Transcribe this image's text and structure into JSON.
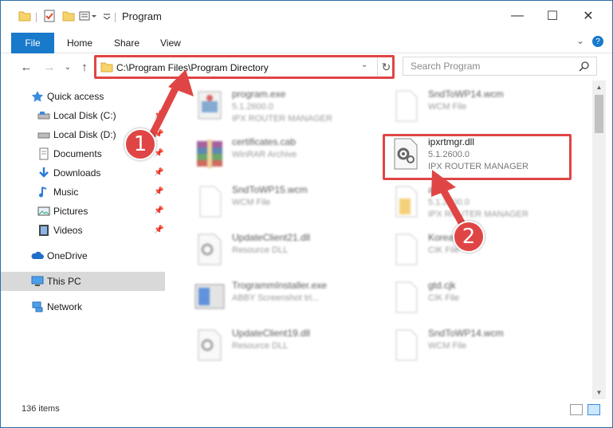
{
  "window": {
    "title": "Program",
    "controls": {
      "minimize": "—",
      "maximize": "☐",
      "close": "✕"
    }
  },
  "ribbon": {
    "tabs": [
      "File",
      "Home",
      "Share",
      "View"
    ],
    "expand": "⌄",
    "help": "?"
  },
  "address": {
    "path": "C:\\Program Files\\Program Directory",
    "dropdown": "⌄",
    "refresh": "↻"
  },
  "search": {
    "placeholder": "Search Program"
  },
  "nav": {
    "back": "←",
    "forward": "→",
    "recent": "⌄",
    "up": "↑",
    "items": [
      {
        "label": "Quick access",
        "icon": "star-icon"
      },
      {
        "label": "Local Disk (C:)",
        "icon": "drive-icon",
        "pinned": true
      },
      {
        "label": "Local Disk (D:)",
        "icon": "drive-icon",
        "pinned": true
      },
      {
        "label": "Documents",
        "icon": "documents-icon",
        "pinned": true
      },
      {
        "label": "Downloads",
        "icon": "download-icon",
        "pinned": true
      },
      {
        "label": "Music",
        "icon": "music-icon",
        "pinned": true
      },
      {
        "label": "Pictures",
        "icon": "pictures-icon",
        "pinned": true
      },
      {
        "label": "Videos",
        "icon": "videos-icon",
        "pinned": true
      },
      {
        "label": "OneDrive",
        "icon": "cloud-icon"
      },
      {
        "label": "This PC",
        "icon": "pc-icon"
      },
      {
        "label": "Network",
        "icon": "network-icon"
      }
    ]
  },
  "files": [
    {
      "name": "program.exe",
      "line2": "5.1.2600.0",
      "line3": "IPX ROUTER MANAGER",
      "icon": "exe-icon"
    },
    {
      "name": "SndToWP14.wcm",
      "line2": "WCM File",
      "line3": "",
      "icon": "file-icon"
    },
    {
      "name": "certificates.cab",
      "line2": "WinRAR Archive",
      "line3": "",
      "icon": "archive-icon"
    },
    {
      "name": "ipxrtmgr.dll",
      "line2": "5.1.2600.0",
      "line3": "IPX ROUTER MANAGER",
      "icon": "dll-icon"
    },
    {
      "name": "SndToWP15.wcm",
      "line2": "WCM File",
      "line3": "",
      "icon": "file-icon"
    },
    {
      "name": "all",
      "line2": "5.1.2600.0",
      "line3": "IPX ROUTER MANAGER",
      "icon": "folder-file-icon"
    },
    {
      "name": "UpdateClient21.dll",
      "line2": "Resource DLL",
      "line3": "",
      "icon": "dll-icon"
    },
    {
      "name": "Korea",
      "line2": "CIK File",
      "line3": "",
      "icon": "file-icon"
    },
    {
      "name": "TrogrammInstaller.exe",
      "line2": "ABBY Screenshot tri...",
      "line3": "",
      "icon": "installer-icon"
    },
    {
      "name": "gtd.cjk",
      "line2": "CIK File",
      "line3": "",
      "icon": "file-icon"
    },
    {
      "name": "UpdateClient19.dll",
      "line2": "Resource DLL",
      "line3": "",
      "icon": "dll-icon"
    },
    {
      "name": "SndToWP14.wcm",
      "line2": "WCM File",
      "line3": "",
      "icon": "file-icon"
    }
  ],
  "status": {
    "count": "136 items"
  },
  "annotations": [
    {
      "number": "1"
    },
    {
      "number": "2"
    }
  ],
  "colors": {
    "accent": "#1979ca",
    "highlight": "#e04545",
    "selected": "#cce8ff"
  }
}
